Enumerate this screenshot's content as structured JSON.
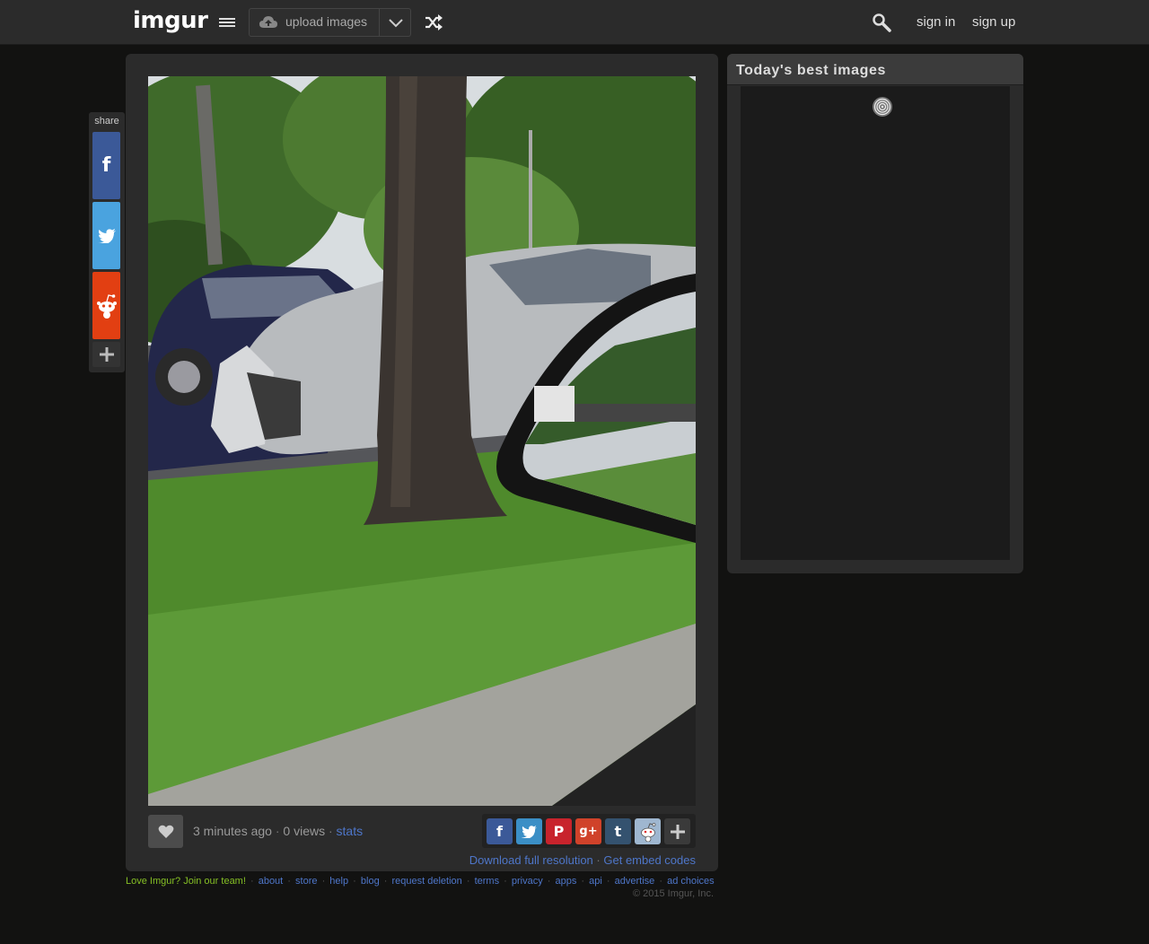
{
  "header": {
    "logo_text": "imgur",
    "upload_label": "upload images",
    "sign_in": "sign in",
    "sign_up": "sign up"
  },
  "share": {
    "label": "share",
    "items": [
      "facebook",
      "twitter",
      "reddit",
      "more"
    ]
  },
  "image": {
    "meta_time": "3 minutes ago",
    "meta_views": "0 views",
    "meta_stats": "stats",
    "download_label": "Download full resolution",
    "embed_label": "Get embed codes",
    "social_icons": [
      "facebook-icon",
      "twitter-icon",
      "pinterest-icon",
      "google-plus-icon",
      "tumblr-icon",
      "reddit-icon",
      "plus-icon"
    ]
  },
  "sidebar": {
    "title": "Today's best images"
  },
  "footer": {
    "join": "Love Imgur? Join our team!",
    "links": [
      "about",
      "store",
      "help",
      "blog",
      "request deletion",
      "terms",
      "privacy",
      "apps",
      "api",
      "advertise",
      "ad choices"
    ],
    "copyright": "© 2015 Imgur, Inc."
  },
  "colors": {
    "background": "#121211",
    "panel": "#2b2b2b",
    "link": "#4e76c9",
    "accent_green": "#85bf25"
  }
}
